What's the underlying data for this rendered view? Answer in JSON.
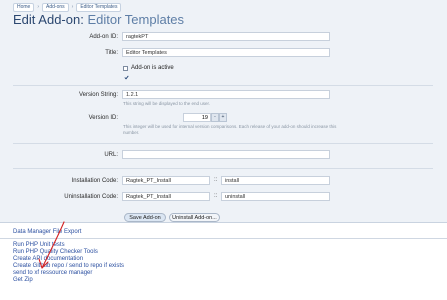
{
  "breadcrumb": [
    "Home",
    "Add-ons",
    "Editor Templates"
  ],
  "page": {
    "title_prefix": "Edit Add-on:",
    "title_entity": "Editor Templates"
  },
  "form": {
    "addon_id": {
      "label": "Add-on ID:",
      "value": "ragtekPT"
    },
    "title": {
      "label": "Title:",
      "value": "Editor Templates"
    },
    "active": {
      "label": "Add-on is active",
      "checked": true
    },
    "version_string": {
      "label": "Version String:",
      "value": "1.2.1",
      "hint": "This string will be displayed to the end user."
    },
    "version_id": {
      "label": "Version ID:",
      "value": "19",
      "minus": "-",
      "plus": "+",
      "hint": "This integer will be used for internal version comparisons. Each release of your add-on should increase this number."
    },
    "url": {
      "label": "URL:",
      "value": ""
    },
    "install": {
      "label": "Installation Code:",
      "class_value": "Ragtek_PT_Install",
      "sep": "::",
      "method_value": "install"
    },
    "uninstall": {
      "label": "Uninstallation Code:",
      "class_value": "Ragtek_PT_Install",
      "sep": "::",
      "method_value": "uninstall"
    },
    "save_label": "Save Add-on",
    "uninstall_btn_label": "Uninstall Add-on..."
  },
  "links": {
    "export": "Data Manager File Export",
    "items": [
      "Run PHP Unit tests",
      "Run PHP Quality Checker Tools",
      "Create API documentation",
      "Create Github repo / send to repo if exists",
      "send to xf ressource manager",
      "Get Zip"
    ]
  },
  "colors": {
    "panel": "#eef2f7",
    "title": "#2b4770",
    "link": "#2b4fa0",
    "annotation": "#d42020"
  }
}
